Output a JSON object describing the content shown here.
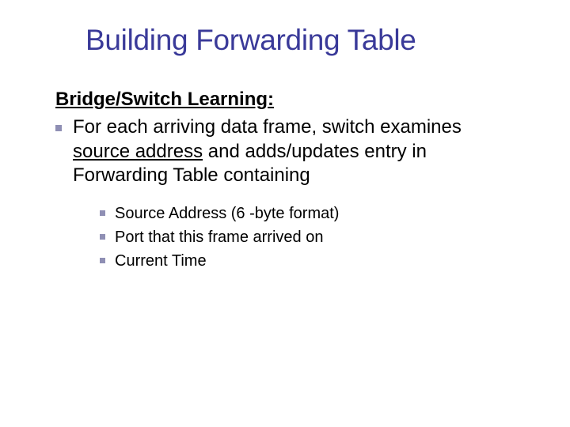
{
  "title": "Building Forwarding Table",
  "subtitle": "Bridge/Switch Learning:",
  "main_bullet": {
    "pre": "For each arriving data frame, switch examines ",
    "u": "source address",
    "post": " and adds/updates entry in Forwarding Table containing"
  },
  "sub_bullets": [
    "Source Address (6 -byte format)",
    "Port that this frame arrived on",
    "Current Time"
  ]
}
